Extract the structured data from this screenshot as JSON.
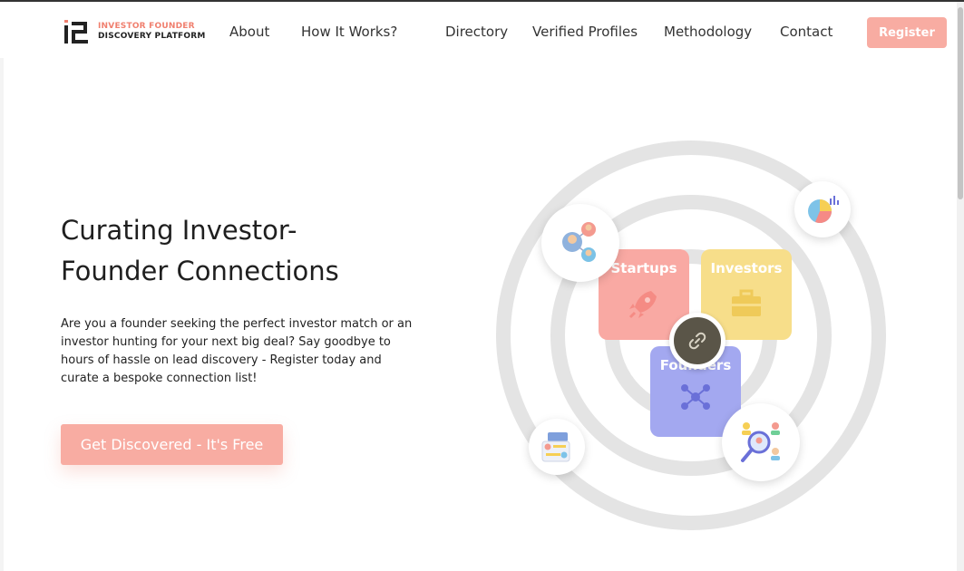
{
  "header": {
    "logo": {
      "line1": "INVESTOR FOUNDER",
      "line2": "DISCOVERY PLATFORM"
    },
    "nav": [
      {
        "label": "About"
      },
      {
        "label": "How It Works?"
      },
      {
        "label": "Directory"
      },
      {
        "label": "Verified Profiles"
      },
      {
        "label": "Methodology"
      },
      {
        "label": "Contact"
      }
    ],
    "register_label": "Register"
  },
  "hero": {
    "title_line1": "Curating Investor-",
    "title_line2": "Founder Connections",
    "description": "Are you a founder seeking the perfect investor match or an investor hunting for your next big deal? Say goodbye to hours of hassle on lead discovery - Register today and curate a bespoke connection list!",
    "cta_label": "Get Discovered - It's Free"
  },
  "illustration": {
    "cards": [
      {
        "label": "Startups",
        "icon": "rocket-icon"
      },
      {
        "label": "Investors",
        "icon": "briefcase-icon"
      },
      {
        "label": "Founders",
        "icon": "network-icon"
      }
    ],
    "center_icon": "link-icon",
    "bubbles": [
      "people-connection-icon",
      "pie-chart-icon",
      "profile-card-icon",
      "search-people-icon"
    ]
  },
  "colors": {
    "accent": "#f8aca2",
    "startups_card": "#f9a9a3",
    "investors_card": "#f7de8a",
    "founders_card": "#a3a8f0",
    "ring": "#e4e4e4"
  }
}
